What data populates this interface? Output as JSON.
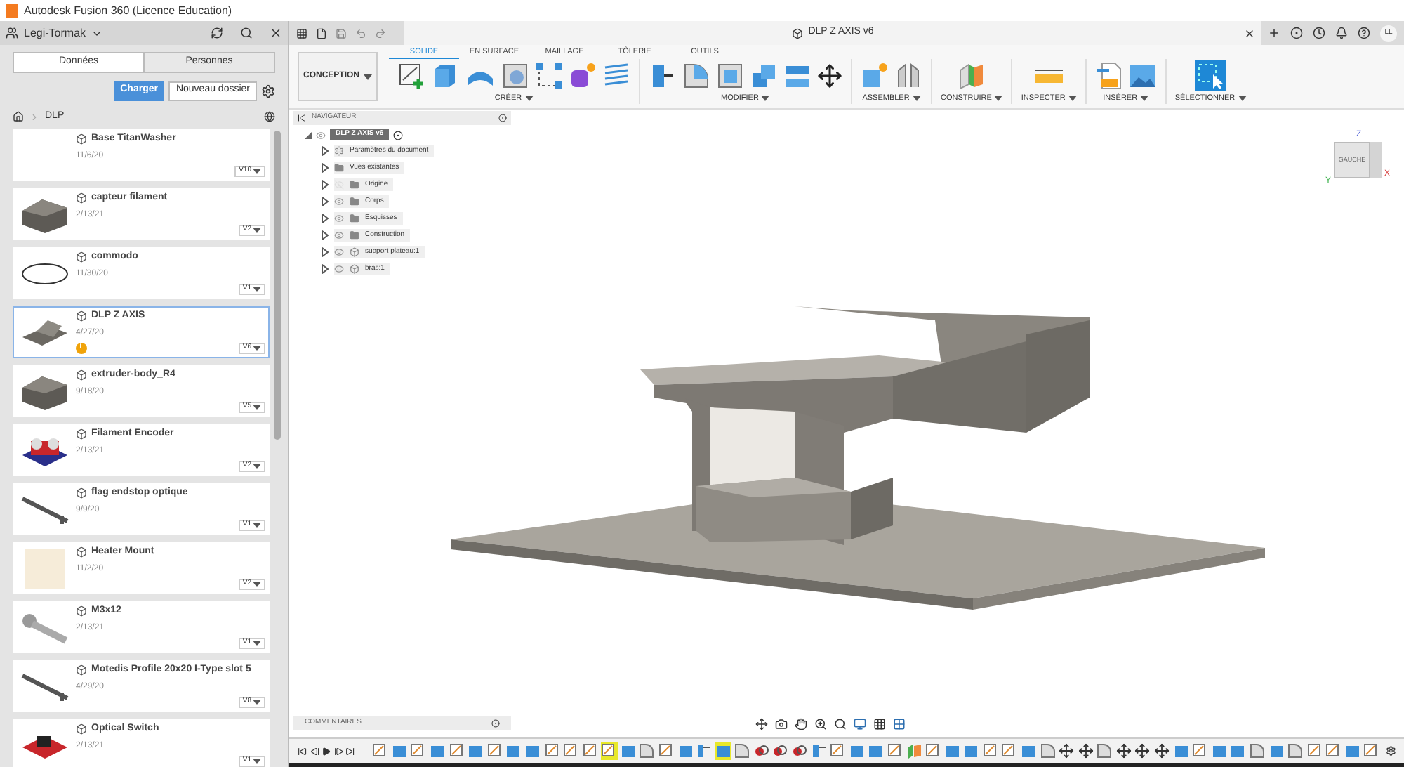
{
  "window": {
    "title": "Autodesk Fusion 360 (Licence Education)"
  },
  "data_panel": {
    "team": "Legi-Tormak",
    "tabs": [
      {
        "label": "Données",
        "selected": true
      },
      {
        "label": "Personnes",
        "selected": false
      }
    ],
    "upload_button": "Charger",
    "new_folder_button": "Nouveau dossier",
    "breadcrumb": "DLP",
    "items": [
      {
        "name": "Base TitanWasher",
        "date": "11/6/20",
        "version": "V10",
        "kind": "none",
        "selected": false
      },
      {
        "name": "capteur filament",
        "date": "2/13/21",
        "version": "V2",
        "kind": "bracket",
        "selected": false
      },
      {
        "name": "commodo",
        "date": "11/30/20",
        "version": "V1",
        "kind": "ring",
        "selected": false
      },
      {
        "name": "DLP Z AXIS",
        "date": "4/27/20",
        "version": "V6",
        "kind": "plate",
        "selected": true,
        "badge": "L"
      },
      {
        "name": "extruder-body_R4",
        "date": "9/18/20",
        "version": "V5",
        "kind": "bracket",
        "selected": false
      },
      {
        "name": "Filament Encoder",
        "date": "2/13/21",
        "version": "V2",
        "kind": "encoder",
        "selected": false
      },
      {
        "name": "flag endstop optique",
        "date": "9/9/20",
        "version": "V1",
        "kind": "rod",
        "selected": false
      },
      {
        "name": "Heater Mount",
        "date": "11/2/20",
        "version": "V2",
        "kind": "cube",
        "selected": false
      },
      {
        "name": "M3x12",
        "date": "2/13/21",
        "version": "V1",
        "kind": "screw",
        "selected": false
      },
      {
        "name": "Motedis Profile 20x20 I-Type slot 5",
        "date": "4/29/20",
        "version": "V8",
        "kind": "rod",
        "selected": false
      },
      {
        "name": "Optical Switch",
        "date": "2/13/21",
        "version": "V1",
        "kind": "switch",
        "selected": false
      }
    ]
  },
  "document_tab": {
    "title": "DLP Z AXIS v6"
  },
  "user_initials": "LL",
  "toolbar": {
    "workspace": "CONCEPTION",
    "tabs": [
      {
        "label": "SOLIDE",
        "selected": true
      },
      {
        "label": "EN SURFACE",
        "selected": false
      },
      {
        "label": "MAILLAGE",
        "selected": false
      },
      {
        "label": "TÔLERIE",
        "selected": false
      },
      {
        "label": "OUTILS",
        "selected": false
      }
    ],
    "groups": [
      {
        "label": "CRÉER",
        "tools": [
          {
            "kind": "sketch"
          },
          {
            "kind": "extrude"
          },
          {
            "kind": "revolve"
          },
          {
            "kind": "hole"
          },
          {
            "kind": "pattern"
          },
          {
            "kind": "form"
          },
          {
            "kind": "coil"
          }
        ]
      },
      {
        "label": "MODIFIER",
        "tools": [
          {
            "kind": "presspull"
          },
          {
            "kind": "fillet"
          },
          {
            "kind": "shell"
          },
          {
            "kind": "combine"
          },
          {
            "kind": "split"
          },
          {
            "kind": "move"
          }
        ]
      },
      {
        "label": "ASSEMBLER",
        "tools": [
          {
            "kind": "component"
          },
          {
            "kind": "joint"
          }
        ]
      },
      {
        "label": "CONSTRUIRE",
        "tools": [
          {
            "kind": "plane"
          }
        ]
      },
      {
        "label": "INSPECTER",
        "tools": [
          {
            "kind": "measure"
          }
        ]
      },
      {
        "label": "INSÉRER",
        "tools": [
          {
            "kind": "insert"
          },
          {
            "kind": "image"
          }
        ]
      },
      {
        "label": "SÉLECTIONNER",
        "tools": [
          {
            "kind": "select"
          }
        ]
      }
    ]
  },
  "navigator": {
    "title": "NAVIGATEUR",
    "root": "DLP Z AXIS v6",
    "children": [
      {
        "label": "Paramètres du document",
        "kind": "settings"
      },
      {
        "label": "Vues existantes",
        "kind": "folder"
      },
      {
        "label": "Origine",
        "kind": "folder",
        "visible": false
      },
      {
        "label": "Corps",
        "kind": "folder",
        "visible": true
      },
      {
        "label": "Esquisses",
        "kind": "folder",
        "visible": true
      },
      {
        "label": "Construction",
        "kind": "folder",
        "visible": true
      },
      {
        "label": "support plateau:1",
        "kind": "component",
        "visible": true
      },
      {
        "label": "bras:1",
        "kind": "component",
        "visible": true
      }
    ]
  },
  "viewcube": {
    "face": "GAUCHE",
    "axis_z": "Z",
    "axis_x": "X",
    "axis_y": "Y"
  },
  "comments": {
    "title": "COMMENTAIRES"
  },
  "timeline": [
    {
      "kind": "sketch",
      "selected": false
    },
    {
      "kind": "body",
      "selected": false
    },
    {
      "kind": "sketch",
      "selected": false
    },
    {
      "kind": "body",
      "selected": false
    },
    {
      "kind": "sketch",
      "selected": false
    },
    {
      "kind": "body",
      "selected": false
    },
    {
      "kind": "sketch",
      "selected": false
    },
    {
      "kind": "body",
      "selected": false
    },
    {
      "kind": "body",
      "selected": false
    },
    {
      "kind": "sketch",
      "selected": false
    },
    {
      "kind": "sketch",
      "selected": false
    },
    {
      "kind": "sketch",
      "selected": false
    },
    {
      "kind": "sketch",
      "selected": true
    },
    {
      "kind": "body",
      "selected": false
    },
    {
      "kind": "fillet",
      "selected": false
    },
    {
      "kind": "sketch",
      "selected": false
    },
    {
      "kind": "body",
      "selected": false
    },
    {
      "kind": "press",
      "selected": false
    },
    {
      "kind": "body",
      "selected": true
    },
    {
      "kind": "fillet",
      "selected": false
    },
    {
      "kind": "combine",
      "selected": false
    },
    {
      "kind": "combine",
      "selected": false
    },
    {
      "kind": "combine",
      "selected": false
    },
    {
      "kind": "press",
      "selected": false
    },
    {
      "kind": "sketch",
      "selected": false
    },
    {
      "kind": "body",
      "selected": false
    },
    {
      "kind": "body",
      "selected": false
    },
    {
      "kind": "sketch",
      "selected": false
    },
    {
      "kind": "plane",
      "selected": false
    },
    {
      "kind": "sketch",
      "selected": false
    },
    {
      "kind": "body",
      "selected": false
    },
    {
      "kind": "body",
      "selected": false
    },
    {
      "kind": "sketch",
      "selected": false
    },
    {
      "kind": "sketch",
      "selected": false
    },
    {
      "kind": "body",
      "selected": false
    },
    {
      "kind": "fillet",
      "selected": false
    },
    {
      "kind": "move",
      "selected": false
    },
    {
      "kind": "move",
      "selected": false
    },
    {
      "kind": "fillet",
      "selected": false
    },
    {
      "kind": "move",
      "selected": false
    },
    {
      "kind": "move",
      "selected": false
    },
    {
      "kind": "move",
      "selected": false
    },
    {
      "kind": "body",
      "selected": false
    },
    {
      "kind": "sketch",
      "selected": false
    },
    {
      "kind": "body",
      "selected": false
    },
    {
      "kind": "body",
      "selected": false
    },
    {
      "kind": "fillet",
      "selected": false
    },
    {
      "kind": "body",
      "selected": false
    },
    {
      "kind": "fillet",
      "selected": false
    },
    {
      "kind": "sketch",
      "selected": false
    },
    {
      "kind": "sketch",
      "selected": false
    },
    {
      "kind": "body",
      "selected": false
    },
    {
      "kind": "sketch",
      "selected": false
    }
  ]
}
